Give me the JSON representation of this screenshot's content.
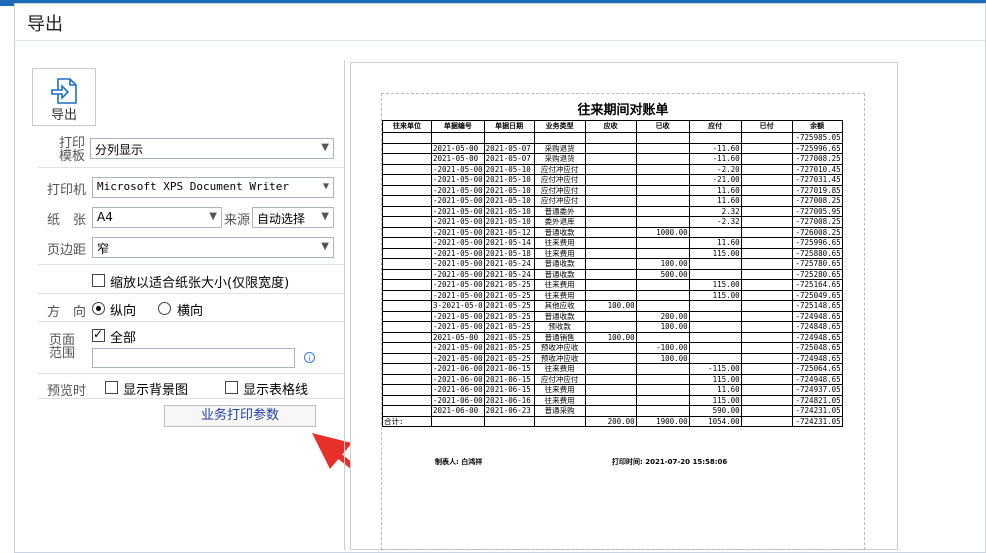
{
  "window": {
    "title": "导出"
  },
  "export_button": {
    "label": "导出"
  },
  "settings": {
    "template": {
      "label": "打印\n模板",
      "value": "分列显示"
    },
    "printer": {
      "label": "打印机",
      "value": "Microsoft XPS Document Writer"
    },
    "paper": {
      "label": "纸　张",
      "value": "A4",
      "source_label": "来源",
      "source_value": "自动选择"
    },
    "margin": {
      "label": "页边距",
      "value": "窄"
    },
    "fit_paper": {
      "label": "缩放以适合纸张大小(仅限宽度)",
      "checked": false
    },
    "orientation": {
      "label": "方　向",
      "options": [
        "纵向",
        "横向"
      ],
      "selected": "纵向"
    },
    "page_range": {
      "label": "页面\n范围",
      "all_label": "全部",
      "all_checked": true,
      "input_value": ""
    },
    "preview": {
      "label": "预览时",
      "show_background": "显示背景图",
      "show_gridlines": "显示表格线"
    },
    "business_button": "业务打印参数"
  },
  "document": {
    "title": "往来期间对账单",
    "columns": [
      "往来单位",
      "单据编号",
      "单据日期",
      "业务类型",
      "应收",
      "已收",
      "应付",
      "已付",
      "余额"
    ],
    "rows": [
      [
        "",
        "",
        "",
        "",
        "",
        "",
        "",
        "",
        "-725985.05"
      ],
      [
        "",
        "2021-05-00",
        "2021-05-07",
        "采购退货",
        "",
        "",
        "-11.60",
        "",
        "-725996.65"
      ],
      [
        "",
        "2021-05-00",
        "2021-05-07",
        "采购退货",
        "",
        "",
        "-11.60",
        "",
        "-727008.25"
      ],
      [
        "",
        "-2021-05-00",
        "2021-05-10",
        "应付冲应付",
        "",
        "",
        "-2.20",
        "",
        "-727010.45"
      ],
      [
        "",
        "-2021-05-00",
        "2021-05-10",
        "应付冲应付",
        "",
        "",
        "-21.00",
        "",
        "-727031.45"
      ],
      [
        "",
        "-2021-05-00",
        "2021-05-10",
        "应付冲应付",
        "",
        "",
        "11.60",
        "",
        "-727019.85"
      ],
      [
        "",
        "-2021-05-00",
        "2021-05-10",
        "应付冲应付",
        "",
        "",
        "11.60",
        "",
        "-727008.25"
      ],
      [
        "",
        "-2021-05-00",
        "2021-05-10",
        "普通委外",
        "",
        "",
        "2.32",
        "",
        "-727005.95"
      ],
      [
        "",
        "-2021-05-00",
        "2021-05-10",
        "委外退库",
        "",
        "",
        "-2.32",
        "",
        "-727008.25"
      ],
      [
        "",
        "-2021-05-00",
        "2021-05-12",
        "普通收款",
        "",
        "1000.00",
        "",
        "",
        "-726008.25"
      ],
      [
        "",
        "-2021-05-00",
        "2021-05-14",
        "往来费用",
        "",
        "",
        "11.60",
        "",
        "-725996.65"
      ],
      [
        "",
        "-2021-05-00",
        "2021-05-18",
        "往来费用",
        "",
        "",
        "115.00",
        "",
        "-725880.65"
      ],
      [
        "",
        "-2021-05-00",
        "2021-05-24",
        "普通收款",
        "",
        "100.00",
        "",
        "",
        "-725780.65"
      ],
      [
        "",
        "-2021-05-00",
        "2021-05-24",
        "普通收款",
        "",
        "500.00",
        "",
        "",
        "-725280.65"
      ],
      [
        "",
        "-2021-05-00",
        "2021-05-25",
        "往来费用",
        "",
        "",
        "115.00",
        "",
        "-725164.65"
      ],
      [
        "",
        "-2021-05-00",
        "2021-05-25",
        "往来费用",
        "",
        "",
        "115.00",
        "",
        "-725049.65"
      ],
      [
        "",
        "3-2021-05-0",
        "2021-05-25",
        "其他应收",
        "100.00",
        "",
        "",
        "",
        "-725148.65"
      ],
      [
        "",
        "-2021-05-00",
        "2021-05-25",
        "普通收款",
        "",
        "200.00",
        "",
        "",
        "-724948.65"
      ],
      [
        "",
        "-2021-05-00",
        "2021-05-25",
        "预收款",
        "",
        "100.00",
        "",
        "",
        "-724848.65"
      ],
      [
        "",
        "2021-05-00",
        "2021-05-25",
        "普通销售",
        "100.00",
        "",
        "",
        "",
        "-724948.65"
      ],
      [
        "",
        "-2021-05-00",
        "2021-05-25",
        "预收冲应收",
        "",
        "-100.00",
        "",
        "",
        "-725048.65"
      ],
      [
        "",
        "-2021-05-00",
        "2021-05-25",
        "预收冲应收",
        "",
        "100.00",
        "",
        "",
        "-724948.65"
      ],
      [
        "",
        "-2021-06-00",
        "2021-06-15",
        "往来费用",
        "",
        "",
        "-115.00",
        "",
        "-725064.65"
      ],
      [
        "",
        "-2021-06-00",
        "2021-06-15",
        "应付冲应付",
        "",
        "",
        "115.00",
        "",
        "-724948.65"
      ],
      [
        "",
        "-2021-06-00",
        "2021-06-15",
        "往来费用",
        "",
        "",
        "11.60",
        "",
        "-724937.05"
      ],
      [
        "",
        "-2021-06-00",
        "2021-06-16",
        "往来费用",
        "",
        "",
        "115.00",
        "",
        "-724821.05"
      ],
      [
        "",
        "2021-06-00",
        "2021-06-23",
        "普通采购",
        "",
        "",
        "590.00",
        "",
        "-724231.05"
      ]
    ],
    "total_row": [
      "合计:",
      "",
      "",
      "",
      "200.00",
      "1900.00",
      "1054.00",
      "",
      "-724231.05"
    ],
    "maker": "制表人: 白鸿祥",
    "print_time": "打印时间: 2021-07-20 15:58:06"
  }
}
